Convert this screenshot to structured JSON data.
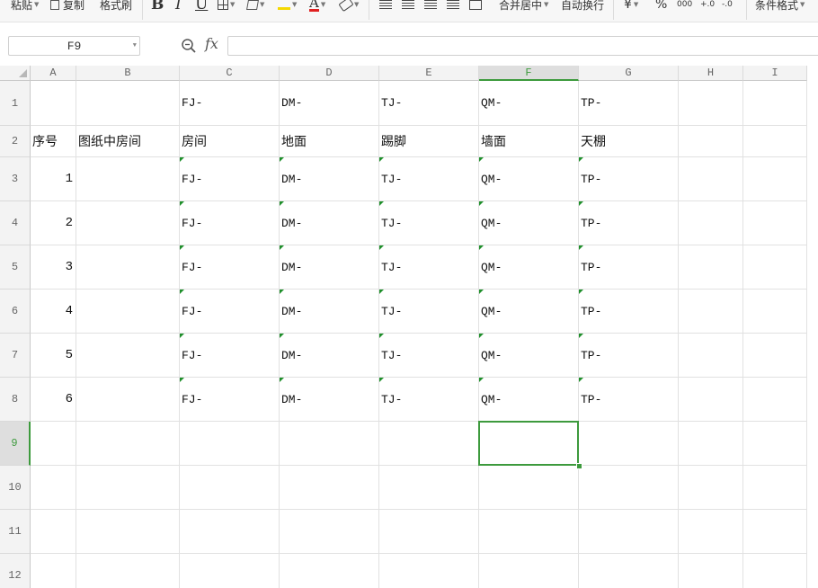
{
  "toolbar": {
    "paste": "粘贴",
    "copy": "复制",
    "format_painter": "格式刷",
    "bold": "B",
    "italic": "I",
    "underline": "U",
    "merge_center": "合并居中",
    "wrap_text": "自动换行",
    "currency": "¥",
    "percent": "%",
    "thousands": "000",
    "inc_decimal": "+.0",
    "dec_decimal": "-.0",
    "conditional_format": "条件格式",
    "font_color": "#e02020",
    "fill_color": "#f5d800"
  },
  "formula_bar": {
    "name_box": "F9",
    "fx": "fx",
    "formula": ""
  },
  "sheet": {
    "columns": [
      "A",
      "B",
      "C",
      "D",
      "E",
      "F",
      "G",
      "H",
      "I"
    ],
    "selected_column": "F",
    "selected_row": "9",
    "rows": [
      {
        "num": "1",
        "cells": [
          "",
          "",
          "FJ-",
          "DM-",
          "TJ-",
          "QM-",
          "TP-",
          "",
          ""
        ]
      },
      {
        "num": "2",
        "cells": [
          "序号",
          "图纸中房间",
          "房间",
          "地面",
          "踢脚",
          "墙面",
          "天棚",
          "",
          ""
        ]
      },
      {
        "num": "3",
        "cells": [
          "1",
          "",
          "FJ-",
          "DM-",
          "TJ-",
          "QM-",
          "TP-",
          "",
          ""
        ]
      },
      {
        "num": "4",
        "cells": [
          "2",
          "",
          "FJ-",
          "DM-",
          "TJ-",
          "QM-",
          "TP-",
          "",
          ""
        ]
      },
      {
        "num": "5",
        "cells": [
          "3",
          "",
          "FJ-",
          "DM-",
          "TJ-",
          "QM-",
          "TP-",
          "",
          ""
        ]
      },
      {
        "num": "6",
        "cells": [
          "4",
          "",
          "FJ-",
          "DM-",
          "TJ-",
          "QM-",
          "TP-",
          "",
          ""
        ]
      },
      {
        "num": "7",
        "cells": [
          "5",
          "",
          "FJ-",
          "DM-",
          "TJ-",
          "QM-",
          "TP-",
          "",
          ""
        ]
      },
      {
        "num": "8",
        "cells": [
          "6",
          "",
          "FJ-",
          "DM-",
          "TJ-",
          "QM-",
          "TP-",
          "",
          ""
        ]
      },
      {
        "num": "9",
        "cells": [
          "",
          "",
          "",
          "",
          "",
          "",
          "",
          "",
          ""
        ]
      },
      {
        "num": "10",
        "cells": [
          "",
          "",
          "",
          "",
          "",
          "",
          "",
          "",
          ""
        ]
      },
      {
        "num": "11",
        "cells": [
          "",
          "",
          "",
          "",
          "",
          "",
          "",
          "",
          ""
        ]
      },
      {
        "num": "12",
        "cells": [
          "",
          "",
          "",
          "",
          "",
          "",
          "",
          "",
          ""
        ]
      }
    ]
  }
}
